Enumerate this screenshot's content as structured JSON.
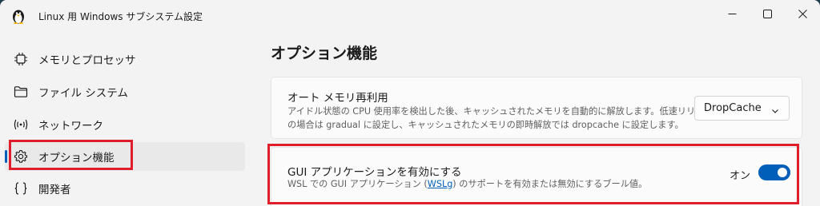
{
  "window": {
    "title": "Linux 用 Windows サブシステム設定",
    "minimize_icon": "minimize-icon",
    "maximize_icon": "maximize-icon",
    "close_icon": "close-icon"
  },
  "sidebar": {
    "items": [
      {
        "label": "メモリとプロセッサ",
        "icon": "chip-icon"
      },
      {
        "label": "ファイル システム",
        "icon": "folder-icon"
      },
      {
        "label": "ネットワーク",
        "icon": "network-icon"
      },
      {
        "label": "オプション機能",
        "icon": "gear-icon",
        "selected": true
      },
      {
        "label": "開発者",
        "icon": "braces-icon"
      }
    ]
  },
  "main": {
    "title": "オプション機能",
    "cards": [
      {
        "title": "オート メモリ再利用",
        "desc_line1": "アイドル状態の CPU 使用率を検出した後、キャッシュされたメモリを自動的に解放します。低速リリース",
        "desc_line2": "の場合は gradual に設定し、キャッシュされたメモリの即時解放では dropcache に設定します。",
        "dropdown_value": "DropCache"
      },
      {
        "title": "GUI アプリケーションを有効にする",
        "desc_prefix": "WSL での GUI アプリケーション (",
        "desc_link": "WSLg",
        "desc_suffix": ") のサポートを有効または無効にするブール値。",
        "toggle_label": "オン",
        "toggle_on": true
      }
    ]
  },
  "colors": {
    "accent": "#005fb8",
    "highlight": "#e01e2b"
  }
}
